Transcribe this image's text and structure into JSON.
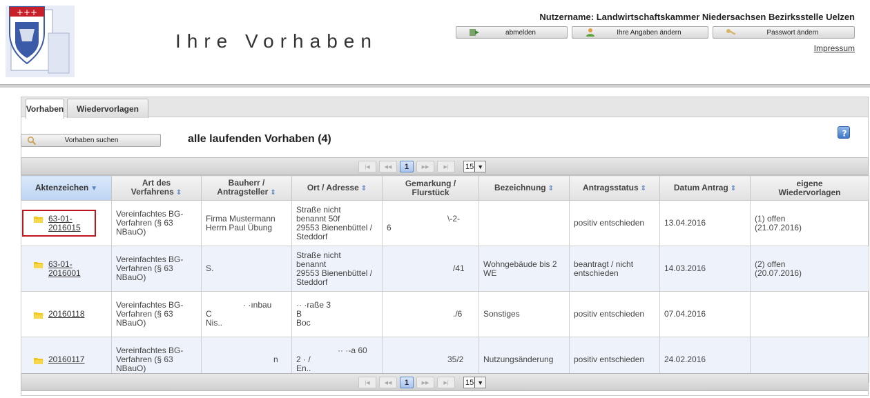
{
  "header": {
    "title": "Ihre Vorhaben",
    "username_label": "Nutzername: Landwirtschaftskammer Niedersachsen Bezirksstelle Uelzen",
    "buttons": {
      "logout": "abmelden",
      "edit_profile": "Ihre Angaben ändern",
      "change_password": "Passwort ändern"
    },
    "impressum": "Impressum"
  },
  "tabs": [
    {
      "label": "Vorhaben",
      "active": true
    },
    {
      "label": "Wiedervorlagen",
      "active": false
    }
  ],
  "toolbar": {
    "search_button": "Vorhaben suchen",
    "list_title": "alle laufenden Vorhaben (4)"
  },
  "pager": {
    "current_page": "1",
    "page_size": "15"
  },
  "table": {
    "columns": [
      "Aktenzeichen",
      "Art des Verfahrens",
      "Bauherr / Antragsteller",
      "Ort / Adresse",
      "Gemarkung / Flurstück",
      "Bezeichnung",
      "Antragsstatus",
      "Datum Antrag",
      "eigene Wiedervorlagen"
    ],
    "columns_lines": {
      "art_1": "Art des",
      "art_2": "Verfahrens",
      "bau_1": "Bauherr /",
      "bau_2": "Antragsteller",
      "gem_1": "Gemarkung /",
      "gem_2": "Flurstück",
      "wv_1": "eigene",
      "wv_2": "Wiedervorlagen"
    },
    "rows": [
      {
        "aktenzeichen_1": "63-01-",
        "aktenzeichen_2": "2016015",
        "verfahren_1": "Vereinfachtes BG-",
        "verfahren_2": "Verfahren (§ 63",
        "verfahren_3": "NBauO)",
        "bauherr_1": "Firma Mustermann",
        "bauherr_2": "Herrn Paul Übung",
        "ort_1": "Straße nicht",
        "ort_2": "benannt 50f",
        "ort_3": "29553 Bienenbüttel /",
        "ort_4": "Steddorf",
        "gemarkung_1": "\\-2-",
        "gemarkung_2": "6",
        "bezeichnung_1": "",
        "bezeichnung_2": "",
        "status_1": "positiv entschieden",
        "status_2": "",
        "datum": "13.04.2016",
        "wv_1": "(1) offen",
        "wv_2": "(21.07.2016)"
      },
      {
        "aktenzeichen_1": "63-01-",
        "aktenzeichen_2": "2016001",
        "verfahren_1": "Vereinfachtes BG-",
        "verfahren_2": "Verfahren (§ 63",
        "verfahren_3": "NBauO)",
        "bauherr_1": "S.",
        "bauherr_2": "",
        "ort_1": "Straße nicht",
        "ort_2": "benannt",
        "ort_3": "29553 Bienenbüttel /",
        "ort_4": "Steddorf",
        "gemarkung_1": "/41",
        "gemarkung_2": "",
        "bezeichnung_1": "Wohngebäude bis 2",
        "bezeichnung_2": "WE",
        "status_1": "beantragt / nicht",
        "status_2": "entschieden",
        "datum": "14.03.2016",
        "wv_1": "(2) offen",
        "wv_2": "(20.07.2016)"
      },
      {
        "aktenzeichen_1": "20160118",
        "aktenzeichen_2": "",
        "verfahren_1": "Vereinfachtes BG-",
        "verfahren_2": "Verfahren (§ 63",
        "verfahren_3": "NBauO)",
        "bauherr_1": "· ·ınbau",
        "bauherr_2": "C",
        "bauherr_3": "Nis..",
        "ort_1": "·· ·raße 3",
        "ort_2": "B",
        "ort_3": "Boc",
        "ort_4": "",
        "gemarkung_1": "./6",
        "gemarkung_2": "",
        "bezeichnung_1": "Sonstiges",
        "bezeichnung_2": "",
        "status_1": "positiv entschieden",
        "status_2": "",
        "datum": "07.04.2016",
        "wv_1": "",
        "wv_2": ""
      },
      {
        "aktenzeichen_1": "20160117",
        "aktenzeichen_2": "",
        "verfahren_1": "Vereinfachtes BG-",
        "verfahren_2": "Verfahren (§ 63",
        "verfahren_3": "NBauO)",
        "bauherr_1": "n",
        "bauherr_2": "",
        "ort_1": "·· ·-a 60",
        "ort_2": "2 ·  /",
        "ort_3": "En..",
        "ort_4": "",
        "gemarkung_1": "35/2",
        "gemarkung_2": "",
        "bezeichnung_1": "Nutzungsänderung",
        "bezeichnung_2": "",
        "status_1": "positiv entschieden",
        "status_2": "",
        "datum": "24.02.2016",
        "wv_1": "",
        "wv_2": ""
      }
    ]
  },
  "colors": {
    "highlight_box": "#c0141e",
    "sorted_header": "#bcd4f3",
    "row_alt": "#eef3fb",
    "folder": "#f0c419"
  }
}
